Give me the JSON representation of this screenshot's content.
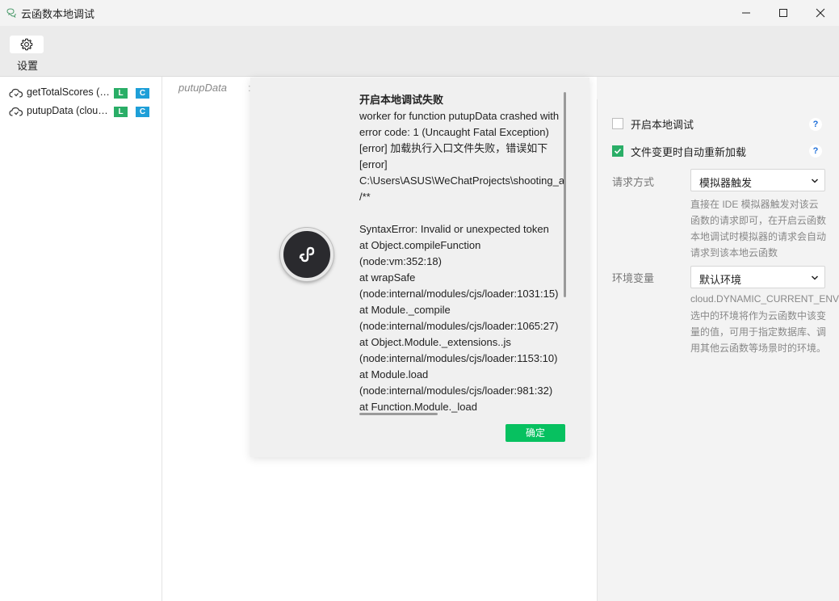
{
  "window": {
    "title": "云函数本地调试",
    "controls": [
      "minimize-icon",
      "maximize-icon",
      "close-icon"
    ]
  },
  "toolbar": {
    "settings_icon": "gear-icon",
    "settings_label": "设置"
  },
  "sidebar": {
    "functions": [
      {
        "name": "getTotalScores (…",
        "tag_l": "L",
        "tag_c": "C"
      },
      {
        "name": "putupData (clou…",
        "tag_l": "L",
        "tag_c": "C"
      }
    ]
  },
  "main": {
    "tab_label": "putupData",
    "tab_separator": ":"
  },
  "dialog": {
    "title": "开启本地调试失败",
    "lines": [
      "worker for function putupData crashed with",
      "error code: 1 (Uncaught Fatal Exception)",
      "[error] 加载执行入口文件失败，错误如下",
      "[error]",
      "C:\\Users\\ASUS\\WeChatProjects\\shooting_a",
      "/**",
      "",
      "SyntaxError: Invalid or unexpected token",
      "at Object.compileFunction",
      "(node:vm:352:18)",
      "at wrapSafe",
      "(node:internal/modules/cjs/loader:1031:15)",
      "at Module._compile",
      "(node:internal/modules/cjs/loader:1065:27)",
      "at Object.Module._extensions..js",
      "(node:internal/modules/cjs/loader:1153:10)",
      "at Module.load",
      "(node:internal/modules/cjs/loader:981:32)",
      "at Function.Module._load"
    ],
    "confirm_label": "确定"
  },
  "settings": {
    "enable_local_debug": {
      "label": "开启本地调试",
      "checked": false,
      "help": "?"
    },
    "auto_reload": {
      "label": "文件变更时自动重新加载",
      "checked": true,
      "help": "?"
    },
    "request_method": {
      "label": "请求方式",
      "value": "模拟器触发",
      "hint": "直接在 IDE 模拟器触发对该云函数的请求即可，在开启云函数本地调试时模拟器的请求会自动请求到该本地云函数"
    },
    "env": {
      "label": "环境变量",
      "value": "默认环境",
      "hint_code": "cloud.DYNAMIC_CURRENT_ENV",
      "hint": "选中的环境将作为云函数中该变量的值，可用于指定数据库、调用其他云函数等场景时的环境。"
    }
  },
  "colors": {
    "accent_green": "#07c160",
    "tag_green": "#2aae67",
    "tag_blue": "#1e9fd8",
    "help_blue": "#1e6fd9"
  }
}
